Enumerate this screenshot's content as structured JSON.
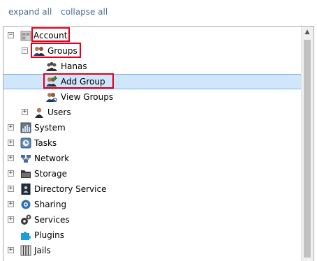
{
  "toolbar": {
    "expand_all": "expand all",
    "collapse_all": "collapse all"
  },
  "tree": {
    "account": "Account",
    "groups": "Groups",
    "hanas": "Hanas",
    "add_group": "Add Group",
    "view_groups": "View Groups",
    "users": "Users",
    "system": "System",
    "tasks": "Tasks",
    "network": "Network",
    "storage": "Storage",
    "directory_service": "Directory Service",
    "sharing": "Sharing",
    "services": "Services",
    "plugins": "Plugins",
    "jails": "Jails"
  },
  "colors": {
    "link": "#4d6f94",
    "highlight": "#e0001b",
    "selection": "#cfe6fb"
  }
}
